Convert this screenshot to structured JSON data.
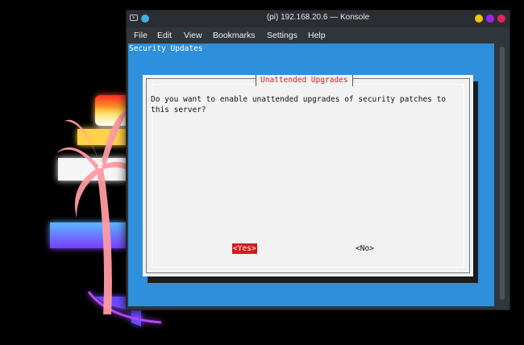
{
  "window": {
    "title": "(pi) 192.168.20.6 — Konsole",
    "controls": {
      "minimize_color": "#f1c40f",
      "maximize_color": "#a020f0",
      "close_color": "#e0245e"
    }
  },
  "menubar": {
    "items": [
      "File",
      "Edit",
      "View",
      "Bookmarks",
      "Settings",
      "Help"
    ]
  },
  "terminal": {
    "background_color": "#2e8fdc",
    "backtitle": "Security Updates",
    "dialog": {
      "title": "Unattended Upgrades",
      "message": "Do you want to enable unattended upgrades of security patches to\nthis server?",
      "yes_label": "<Yes>",
      "no_label": "<No>",
      "selected": "yes",
      "accent_color": "#d21c1c"
    }
  },
  "icons": {
    "app": "konsole-icon",
    "pin": "pin-icon"
  }
}
